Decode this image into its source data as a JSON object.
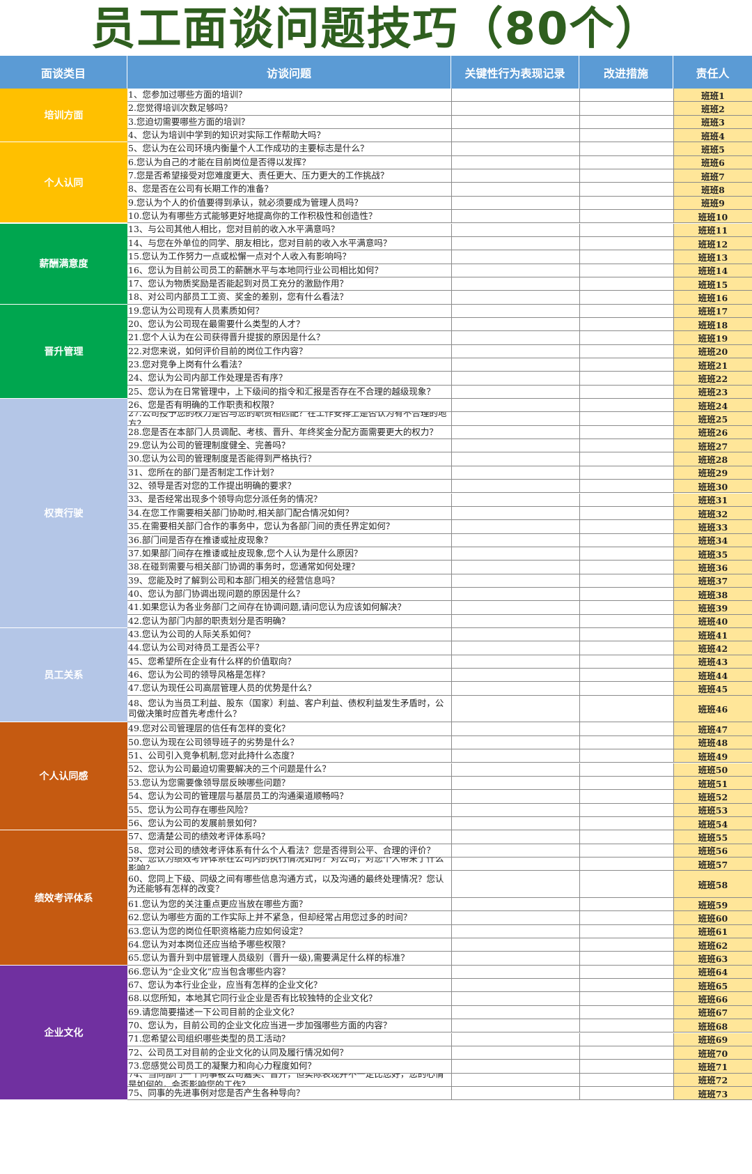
{
  "title": "员工面谈问题技巧（80个）",
  "headers": [
    "面谈类目",
    "访谈问题",
    "关键性行为表现记录",
    "改进措施",
    "责任人"
  ],
  "categories": [
    {
      "name": "培训方面",
      "color": "#ffc000",
      "count": 4
    },
    {
      "name": "个人认同",
      "color": "#ffc000",
      "count": 6
    },
    {
      "name": "薪酬满意度",
      "color": "#00a64f",
      "count": 6
    },
    {
      "name": "晋升管理",
      "color": "#00a64f",
      "count": 7
    },
    {
      "name": "权责行驶",
      "color": "#b4c6e7",
      "count": 17
    },
    {
      "name": "员工关系",
      "color": "#b4c6e7",
      "count": 6
    },
    {
      "name": "个人认同感",
      "color": "#c55a11",
      "count": 8
    },
    {
      "name": "绩效考评体系",
      "color": "#c55a11",
      "count": 9
    },
    {
      "name": "企业文化",
      "color": "#7030a0",
      "count": 10
    }
  ],
  "rows": [
    {
      "q": "1、您参加过哪些方面的培训？",
      "owner": "班班1"
    },
    {
      "q": "2.您觉得培训次数足够吗？",
      "owner": "班班2"
    },
    {
      "q": "3.您迫切需要哪些方面的培训？",
      "owner": "班班3"
    },
    {
      "q": "4、您认为培训中学到的知识对实际工作帮助大吗？",
      "owner": "班班4"
    },
    {
      "q": "5、您认为在公司环境内衡量个人工作成功的主要标志是什么？",
      "owner": "班班5"
    },
    {
      "q": "6.您认为自己的才能在目前岗位是否得以发挥？",
      "owner": "班班6"
    },
    {
      "q": "7.您是否希望接受对您难度更大、责任更大、压力更大的工作挑战？",
      "owner": "班班7"
    },
    {
      "q": "8、您是否在公司有长期工作的准备？",
      "owner": "班班8"
    },
    {
      "q": "9.您认为个人的价值要得到承认，就必须要成为管理人员吗？",
      "owner": "班班9"
    },
    {
      "q": "10.您认为有哪些方式能够更好地提高你的工作积极性和创造性？",
      "owner": "班班10"
    },
    {
      "q": "13、与公司其他人相比，您对目前的收入水平满意吗？",
      "owner": "班班11"
    },
    {
      "q": "14、与您在外单位的同学、朋友相比，您对目前的收入水平满意吗？",
      "owner": "班班12"
    },
    {
      "q": "15.您认为工作努力一点或松懈一点对个人收入有影响吗？",
      "owner": "班班13"
    },
    {
      "q": "16、您认为目前公司员工的薪酬水平与本地同行业公司相比如何？",
      "owner": "班班14"
    },
    {
      "q": "17、您认为物质奖励是否能起到对员工充分的激励作用？",
      "owner": "班班15"
    },
    {
      "q": "18、对公司内部员工工资、奖金的差别，您有什么看法？",
      "owner": "班班16"
    },
    {
      "q": "19.您认为公司现有人员素质如何？",
      "owner": "班班17"
    },
    {
      "q": "20、您认为公司现在最需要什么类型的人才？",
      "owner": "班班18"
    },
    {
      "q": "21.您个人认为在公司获得晋升提拔的原因是什么？",
      "owner": "班班19"
    },
    {
      "q": "22.对您来说，如何评价目前的岗位工作内容？",
      "owner": "班班20"
    },
    {
      "q": "23.您对竞争上岗有什么看法？",
      "owner": "班班21"
    },
    {
      "q": "24、您认为公司内部工作处理是否有序？",
      "owner": "班班22"
    },
    {
      "q": "25、您认为在日常管理中，上下级间的指令和汇报是否存在不合理的越级现象？",
      "owner": "班班23"
    },
    {
      "q": "26、您是否有明确的工作职责和权限？",
      "owner": "班班24"
    },
    {
      "q": "27.公司授予您的权力是否与您的职责相匹配？在工作安排上是否认为有不合理的地方？",
      "owner": "班班25"
    },
    {
      "q": "28.您是否在本部门人员调配、考核、晋升、年终奖金分配方面需要更大的权力？",
      "owner": "班班26"
    },
    {
      "q": "29.您认为公司的管理制度健全、完善吗？",
      "owner": "班班27"
    },
    {
      "q": "30.您认为公司的管理制度是否能得到严格执行？",
      "owner": "班班28"
    },
    {
      "q": "31、您所在的部门是否制定工作计划？",
      "owner": "班班29"
    },
    {
      "q": "32、领导是否对您的工作提出明确的要求？",
      "owner": "班班30"
    },
    {
      "q": "33、是否经常出现多个领导向您分派任务的情况？",
      "owner": "班班31"
    },
    {
      "q": "34.在您工作需要相关部门协助时,相关部门配合情况如何？",
      "owner": "班班32"
    },
    {
      "q": "35.在需要相关部门合作的事务中，您认为各部门间的责任界定如何？",
      "owner": "班班33"
    },
    {
      "q": "36.部门间是否存在推诿或扯皮现象？",
      "owner": "班班34"
    },
    {
      "q": "37.如果部门间存在推诿或扯皮现象,您个人认为是什么原因？",
      "owner": "班班35"
    },
    {
      "q": "38.在碰到需要与相关部门协调的事务时，您通常如何处理？",
      "owner": "班班36"
    },
    {
      "q": "39、您能及时了解到公司和本部门相关的经营信息吗？",
      "owner": "班班37"
    },
    {
      "q": "40、您认为部门协调出现问题的原因是什么？",
      "owner": "班班38"
    },
    {
      "q": "41.如果您认为各业务部门之间存在协调问题,请问您认为应该如何解决？",
      "owner": "班班39"
    },
    {
      "q": "42.您认为部门内部的职责划分是否明确？",
      "owner": "班班40"
    },
    {
      "q": "43.您认为公司的人际关系如何？",
      "owner": "班班41"
    },
    {
      "q": "44.您认为公司对待员工是否公平？",
      "owner": "班班42"
    },
    {
      "q": "45、您希望所在企业有什么样的价值取向？",
      "owner": "班班43"
    },
    {
      "q": "46、您认为公司的领导风格是怎样？",
      "owner": "班班44"
    },
    {
      "q": "47.您认为现任公司高层管理人员的优势是什么？",
      "owner": "班班45"
    },
    {
      "q": "48、您认为当员工利益、股东（国家）利益、客户利益、债权利益发生矛盾时，公司做决策时应首先考虑什么？",
      "owner": "班班46"
    },
    {
      "q": "49.您对公司管理层的信任有怎样的变化？",
      "owner": "班班47"
    },
    {
      "q": "50.您认为现在公司领导班子的劣势是什么？",
      "owner": "班班48"
    },
    {
      "q": "51、公司引入竞争机制,您对此持什么态度？",
      "owner": "班班49"
    },
    {
      "q": "52、您认为公司最迫切需要解决的三个问题是什么？",
      "owner": "班班50"
    },
    {
      "q": "53.您认为您需要像领导层反映哪些问题？",
      "owner": "班班51"
    },
    {
      "q": "54、您认为公司的管理层与基层员工的沟通渠道顺畅吗？",
      "owner": "班班52"
    },
    {
      "q": "55、您认为公司存在哪些风险？",
      "owner": "班班53"
    },
    {
      "q": "56、您认为公司的发展前景如何？",
      "owner": "班班54"
    },
    {
      "q": "57、您清楚公司的绩效考评体系吗？",
      "owner": "班班55"
    },
    {
      "q": "58、您对公司的绩效考评体系有什么个人看法？您是否得到公平、合理的评价？",
      "owner": "班班56"
    },
    {
      "q": "59、您认为绩效考评体系在公司内的执行情况如何？对公司，对您个人带来了什么影响？",
      "owner": "班班57"
    },
    {
      "q": "60、您同上下级、同级之间有哪些信息沟通方式，以及沟通的最终处理情况？您认为还能够有怎样的改变？",
      "owner": "班班58"
    },
    {
      "q": "61.您认为您的关注重点更应当放在哪些方面？",
      "owner": "班班59"
    },
    {
      "q": "62.您认为哪些方面的工作实际上并不紧急，但却经常占用您过多的时间？",
      "owner": "班班60"
    },
    {
      "q": "63.您认为您的岗位任职资格能力应如何设定？",
      "owner": "班班61"
    },
    {
      "q": "64.您认为对本岗位还应当给予哪些权限？",
      "owner": "班班62"
    },
    {
      "q": "65.您认为晋升到中层管理人员级别（晋升一级),需要满足什么样的标准？",
      "owner": "班班63"
    },
    {
      "q": "66.您认为“企业文化”应当包含哪些内容？",
      "owner": "班班64"
    },
    {
      "q": "67、您认为本行业企业，应当有怎样的企业文化？",
      "owner": "班班65"
    },
    {
      "q": "68.以您所知，本地其它同行业企业是否有比较独特的企业文化？",
      "owner": "班班66"
    },
    {
      "q": "69.请您简要描述一下公司目前的企业文化？",
      "owner": "班班67"
    },
    {
      "q": "70、您认为，目前公司的企业文化应当进一步加强哪些方面的内容？",
      "owner": "班班68"
    },
    {
      "q": "71.您希望公司组织哪些类型的员工活动？",
      "owner": "班班69"
    },
    {
      "q": "72、公司员工对目前的企业文化的认同及履行情况如何？",
      "owner": "班班70"
    },
    {
      "q": "73.您感觉公司员工的凝聚力和向心力程度如何？",
      "owner": "班班71"
    },
    {
      "q": "74、当同部门一个同事被公司嘉奖、晋升，但实际表现并不一定比您好，您的心情是如何的，会否影响您的工作？",
      "owner": "班班72"
    },
    {
      "q": "75、同事的先进事例对您是否产生各种导向？",
      "owner": "班班73"
    }
  ]
}
